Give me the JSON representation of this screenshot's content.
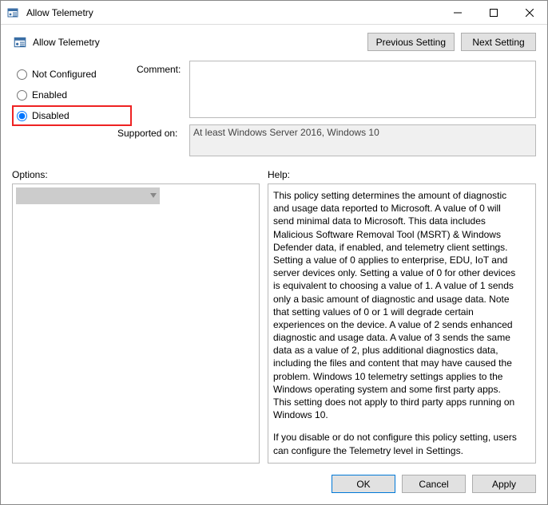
{
  "window": {
    "title": "Allow Telemetry"
  },
  "header": {
    "title": "Allow Telemetry",
    "prevLabel": "Previous Setting",
    "nextLabel": "Next Setting"
  },
  "state": {
    "notConfigured": "Not Configured",
    "enabled": "Enabled",
    "disabled": "Disabled",
    "selected": "disabled"
  },
  "labels": {
    "comment": "Comment:",
    "supported": "Supported on:",
    "options": "Options:",
    "help": "Help:"
  },
  "fields": {
    "comment": "",
    "supported": "At least Windows Server 2016, Windows 10"
  },
  "help": {
    "p1": "This policy setting determines the amount of diagnostic and usage data reported to Microsoft. A value of 0 will send minimal data to Microsoft. This data includes Malicious Software Removal Tool (MSRT) & Windows Defender data, if enabled, and telemetry client settings. Setting a value of 0 applies to enterprise, EDU, IoT and server devices only. Setting a value of 0 for other devices is equivalent to choosing a value of 1. A value of 1 sends only a basic amount of diagnostic and usage data. Note that setting values of 0 or 1 will degrade certain experiences on the device. A value of 2 sends enhanced diagnostic and usage data. A value of 3 sends the same data as a value of 2, plus additional diagnostics data, including the files and content that may have caused the problem. Windows 10 telemetry settings applies to the Windows operating system and some first party apps. This setting does not apply to third party apps running on Windows 10.",
    "p2": "If you disable or do not configure this policy setting, users can configure the Telemetry level in Settings."
  },
  "footer": {
    "ok": "OK",
    "cancel": "Cancel",
    "apply": "Apply"
  }
}
